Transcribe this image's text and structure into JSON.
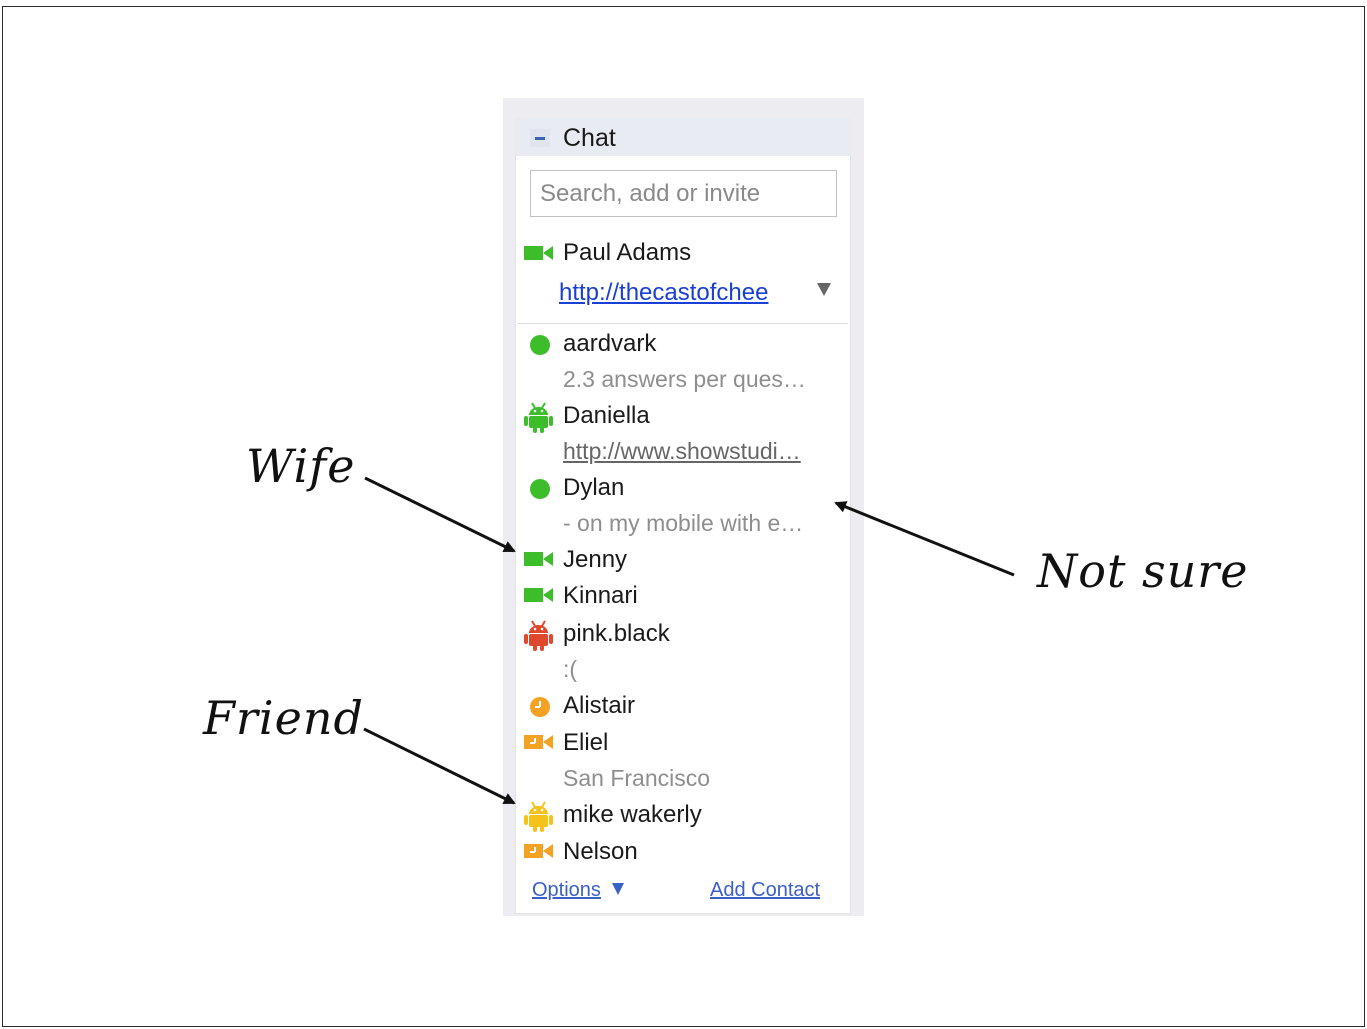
{
  "chat": {
    "title": "Chat",
    "search_placeholder": "Search, add or invite",
    "me": {
      "name": "Paul Adams",
      "link": "http://thecastofchee",
      "status_icon": "video-camera-icon",
      "status_color": "#3dbd2a"
    },
    "contacts": [
      {
        "name": "aardvark",
        "status": "2.3 answers per ques…",
        "status_is_link": false,
        "icon": "online-dot-icon",
        "color": "#3dbd2a"
      },
      {
        "name": "Daniella",
        "status": "http://www.showstudi…",
        "status_is_link": true,
        "icon": "android-icon",
        "color": "#3dbd2a"
      },
      {
        "name": "Dylan",
        "status": "- on my mobile with e…",
        "status_is_link": false,
        "icon": "online-dot-icon",
        "color": "#3dbd2a"
      },
      {
        "name": "Jenny",
        "status": "",
        "status_is_link": false,
        "icon": "video-camera-icon",
        "color": "#3dbd2a"
      },
      {
        "name": "Kinnari",
        "status": "",
        "status_is_link": false,
        "icon": "video-camera-icon",
        "color": "#3dbd2a"
      },
      {
        "name": "pink.black",
        "status": ":(",
        "status_is_link": false,
        "icon": "android-icon",
        "color": "#e0482e"
      },
      {
        "name": "Alistair",
        "status": "",
        "status_is_link": false,
        "icon": "idle-clock-icon",
        "color": "#f4a223"
      },
      {
        "name": "Eliel",
        "status": "San Francisco",
        "status_is_link": false,
        "icon": "video-camera-icon",
        "color": "#f4a223"
      },
      {
        "name": "mike wakerly",
        "status": "",
        "status_is_link": false,
        "icon": "android-icon",
        "color": "#f4c21a"
      },
      {
        "name": "Nelson",
        "status": "",
        "status_is_link": false,
        "icon": "video-camera-icon",
        "color": "#f4a223"
      }
    ],
    "footer": {
      "options_label": "Options",
      "add_contact_label": "Add Contact"
    }
  },
  "annotations": {
    "wife": "Wife",
    "not_sure": "Not sure",
    "friend": "Friend"
  }
}
